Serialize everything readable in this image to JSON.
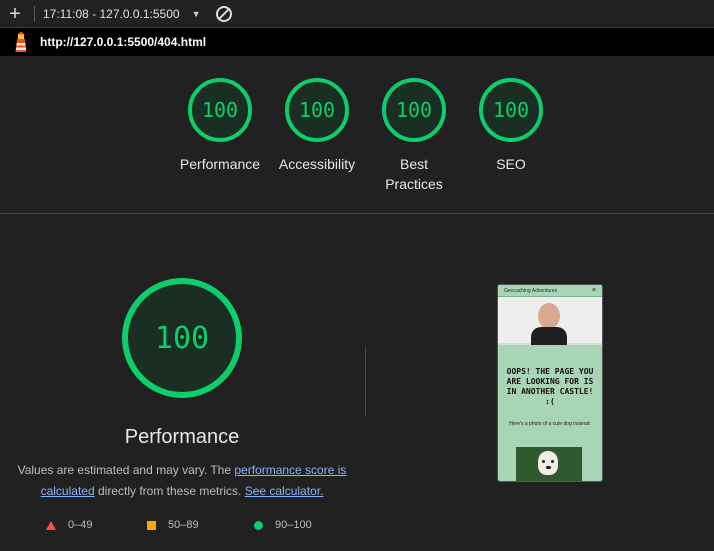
{
  "toolbar": {
    "add_label": "+",
    "report_label": "17:11:08 - 127.0.0.1:5500",
    "caret": "▼"
  },
  "urlbar": {
    "url": "http://127.0.0.1:5500/404.html"
  },
  "gauges": [
    {
      "score": "100",
      "label": "Performance"
    },
    {
      "score": "100",
      "label": "Accessibility"
    },
    {
      "score": "100",
      "label": "Best Practices"
    },
    {
      "score": "100",
      "label": "SEO"
    }
  ],
  "performance": {
    "score": "100",
    "title": "Performance",
    "desc_prefix": "Values are estimated and may vary. The ",
    "desc_link1": "performance score is calculated",
    "desc_middle": " directly from these metrics. ",
    "desc_link2": "See calculator."
  },
  "legend": {
    "fail": "0–49",
    "average": "50–89",
    "pass": "90–100"
  },
  "thumbnail": {
    "nav_title": "Geocaching Adventures",
    "nav_menu": "≡",
    "heading": "OOPS! THE PAGE YOU ARE LOOKING FOR IS IN ANOTHER CASTLE! :(",
    "subtext": "Here's a photo of a cute dog instead:"
  },
  "colors": {
    "pass": "#0cce6b",
    "average": "#ffa400",
    "fail": "#ff4e42",
    "link": "#8ab4f8"
  }
}
